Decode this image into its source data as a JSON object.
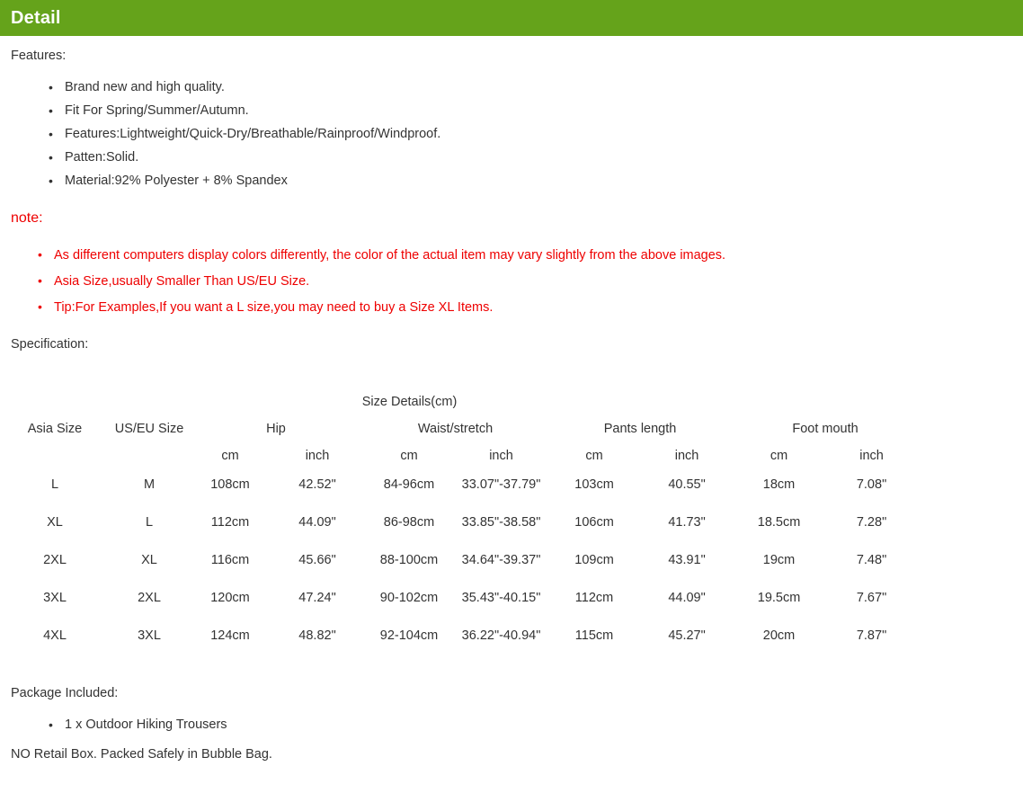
{
  "header": {
    "title": "Detail",
    "bar_color": "#65a31b",
    "title_color": "#ffffff"
  },
  "features": {
    "label": "Features:",
    "items": [
      "Brand new and high quality.",
      "Fit For Spring/Summer/Autumn.",
      "Features:Lightweight/Quick-Dry/Breathable/Rainproof/Windproof.",
      "Patten:Solid.",
      "Material:92% Polyester + 8% Spandex"
    ]
  },
  "note": {
    "label": "note:",
    "color": "#ee0000",
    "items": [
      "As different computers display colors differently, the color of the actual item may vary slightly from the above images.",
      "Asia Size,usually Smaller Than US/EU Size.",
      "Tip:For Examples,If you want a L size,you may need to buy a Size XL Items."
    ]
  },
  "specification": {
    "label": "Specification:",
    "table": {
      "caption": "Size Details(cm)",
      "group_headers": [
        "Asia Size",
        "US/EU Size",
        "Hip",
        "Waist/stretch",
        "Pants length",
        "Foot mouth"
      ],
      "unit_headers": [
        "cm",
        "inch",
        "cm",
        "inch",
        "cm",
        "inch",
        "cm",
        "inch"
      ],
      "rows": [
        {
          "asia_size": "L",
          "us_eu_size": "M",
          "hip_cm": "108cm",
          "hip_inch": "42.52\"",
          "waist_cm": "84-96cm",
          "waist_inch": "33.07\"-37.79\"",
          "pants_length_cm": "103cm",
          "pants_length_inch": "40.55\"",
          "foot_mouth_cm": "18cm",
          "foot_mouth_inch": "7.08\""
        },
        {
          "asia_size": "XL",
          "us_eu_size": "L",
          "hip_cm": "112cm",
          "hip_inch": "44.09\"",
          "waist_cm": "86-98cm",
          "waist_inch": "33.85\"-38.58\"",
          "pants_length_cm": "106cm",
          "pants_length_inch": "41.73\"",
          "foot_mouth_cm": "18.5cm",
          "foot_mouth_inch": "7.28\""
        },
        {
          "asia_size": "2XL",
          "us_eu_size": "XL",
          "hip_cm": "116cm",
          "hip_inch": "45.66\"",
          "waist_cm": "88-100cm",
          "waist_inch": "34.64\"-39.37\"",
          "pants_length_cm": "109cm",
          "pants_length_inch": "43.91\"",
          "foot_mouth_cm": "19cm",
          "foot_mouth_inch": "7.48\""
        },
        {
          "asia_size": "3XL",
          "us_eu_size": "2XL",
          "hip_cm": "120cm",
          "hip_inch": "47.24\"",
          "waist_cm": "90-102cm",
          "waist_inch": "35.43\"-40.15\"",
          "pants_length_cm": "112cm",
          "pants_length_inch": "44.09\"",
          "foot_mouth_cm": "19.5cm",
          "foot_mouth_inch": "7.67\""
        },
        {
          "asia_size": "4XL",
          "us_eu_size": "3XL",
          "hip_cm": "124cm",
          "hip_inch": "48.82\"",
          "waist_cm": "92-104cm",
          "waist_inch": "36.22\"-40.94\"",
          "pants_length_cm": "115cm",
          "pants_length_inch": "45.27\"",
          "foot_mouth_cm": "20cm",
          "foot_mouth_inch": "7.87\""
        }
      ]
    }
  },
  "package": {
    "label": "Package Included:",
    "items": [
      "1 x Outdoor Hiking Trousers"
    ],
    "footnote": "NO Retail Box. Packed Safely in Bubble Bag."
  }
}
